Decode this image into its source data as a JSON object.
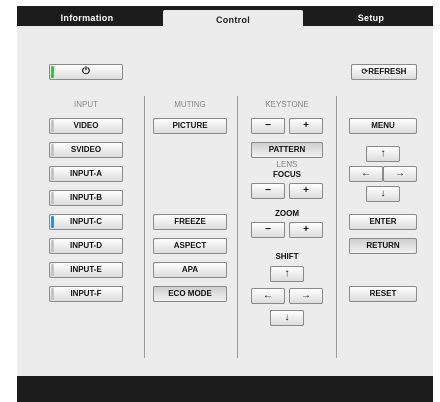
{
  "tabs": [
    {
      "label": "Information",
      "active": false
    },
    {
      "label": "Control",
      "active": true
    },
    {
      "label": "Setup",
      "active": false
    }
  ],
  "power": {
    "icon": "power-icon",
    "glyph": "⏻",
    "indicator_color": "#3fbf3f"
  },
  "refresh": {
    "icon": "refresh-icon",
    "glyph": "⟳",
    "label": "REFRESH"
  },
  "input": {
    "header": "INPUT",
    "items": [
      {
        "label": "VIDEO",
        "selected": false
      },
      {
        "label": "SVIDEO",
        "selected": false
      },
      {
        "label": "INPUT-A",
        "selected": false
      },
      {
        "label": "INPUT-B",
        "selected": false
      },
      {
        "label": "INPUT-C",
        "selected": true
      },
      {
        "label": "INPUT-D",
        "selected": false
      },
      {
        "label": "INPUT-E",
        "selected": false
      },
      {
        "label": "INPUT-F",
        "selected": false
      }
    ],
    "selected_color": "#2f8fe0"
  },
  "muting": {
    "header": "MUTING",
    "picture": "PICTURE",
    "freeze": "FREEZE",
    "aspect": "ASPECT",
    "apa": "APA",
    "eco_mode": "ECO MODE"
  },
  "keystone": {
    "header": "KEYSTONE",
    "minus": "−",
    "plus": "+",
    "pattern": "PATTERN",
    "lens_header": "LENS",
    "focus_label": "FOCUS",
    "zoom_label": "ZOOM",
    "shift_label": "SHIFT"
  },
  "arrows": {
    "up": "↑",
    "down": "↓",
    "left": "←",
    "right": "→"
  },
  "menu": {
    "menu": "MENU",
    "enter": "ENTER",
    "return": "RETURN",
    "reset": "RESET"
  }
}
